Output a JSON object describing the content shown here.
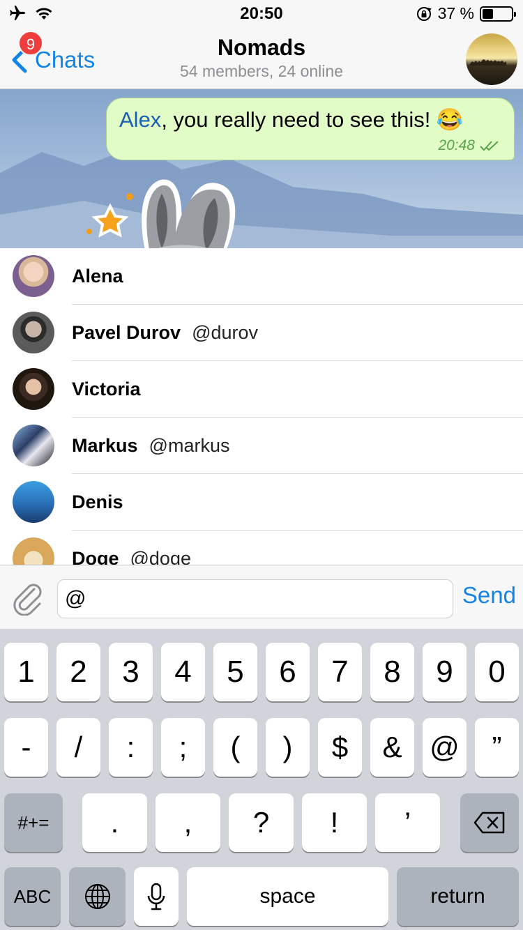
{
  "status_bar": {
    "time": "20:50",
    "battery_percent": "37 %",
    "battery_level": 0.37,
    "icons": [
      "airplane-icon",
      "wifi-icon",
      "rotation-lock-icon",
      "battery-icon"
    ]
  },
  "navbar": {
    "back_label": "Chats",
    "badge_count": "9",
    "title": "Nomads",
    "subtitle": "54 members, 24 online"
  },
  "message": {
    "mention": "Alex",
    "text": ", you really need to see this! 😂",
    "time": "20:48"
  },
  "mentions": [
    {
      "name": "Alena",
      "username": ""
    },
    {
      "name": "Pavel Durov",
      "username": "@durov"
    },
    {
      "name": "Victoria",
      "username": ""
    },
    {
      "name": "Markus",
      "username": "@markus"
    },
    {
      "name": "Denis",
      "username": ""
    },
    {
      "name": "Doge",
      "username": "@doge"
    }
  ],
  "input": {
    "value": "@",
    "send_label": "Send"
  },
  "keyboard": {
    "row1": [
      "1",
      "2",
      "3",
      "4",
      "5",
      "6",
      "7",
      "8",
      "9",
      "0"
    ],
    "row2": [
      "-",
      "/",
      ":",
      ";",
      "(",
      ")",
      "$",
      "&",
      "@",
      "”"
    ],
    "row3": [
      ".",
      ",",
      "?",
      "!",
      "’"
    ],
    "more_symbols": "#+=",
    "abc": "ABC",
    "space": "space",
    "return": "return"
  },
  "colors": {
    "accent": "#1483e6",
    "badge": "#ee3d3c",
    "bubble": "#e2fcc8",
    "mention": "#1a5fb4"
  }
}
